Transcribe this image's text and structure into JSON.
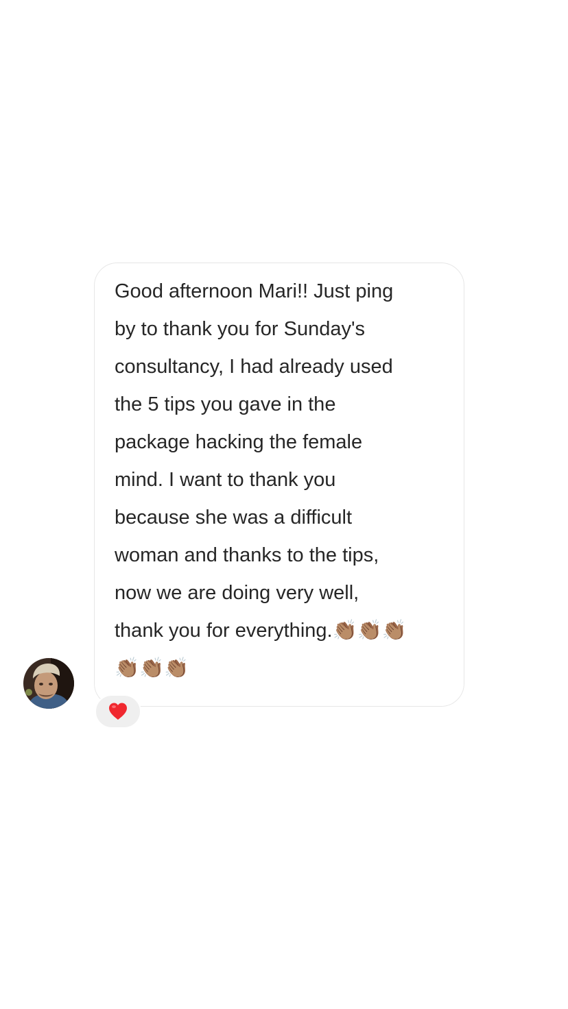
{
  "message": {
    "text": "Good afternoon Mari!! Just ping\nby to thank you for Sunday's\nconsultancy, I had already used\nthe 5 tips you gave in the\npackage hacking the female\nmind. I want to thank you\nbecause she was a difficult\nwoman and thanks to the tips,\nnow we are doing very well,\nthank you for everything.👏🏽👏🏽👏🏽\n👏🏽👏🏽👏🏽",
    "bubble_border_color": "#e6e6e6",
    "text_color": "#262626"
  },
  "sender": {
    "avatar_icon": "profile-photo"
  },
  "reaction": {
    "icon": "heart-icon",
    "color": "#f0282f",
    "pill_color": "#efefef"
  }
}
